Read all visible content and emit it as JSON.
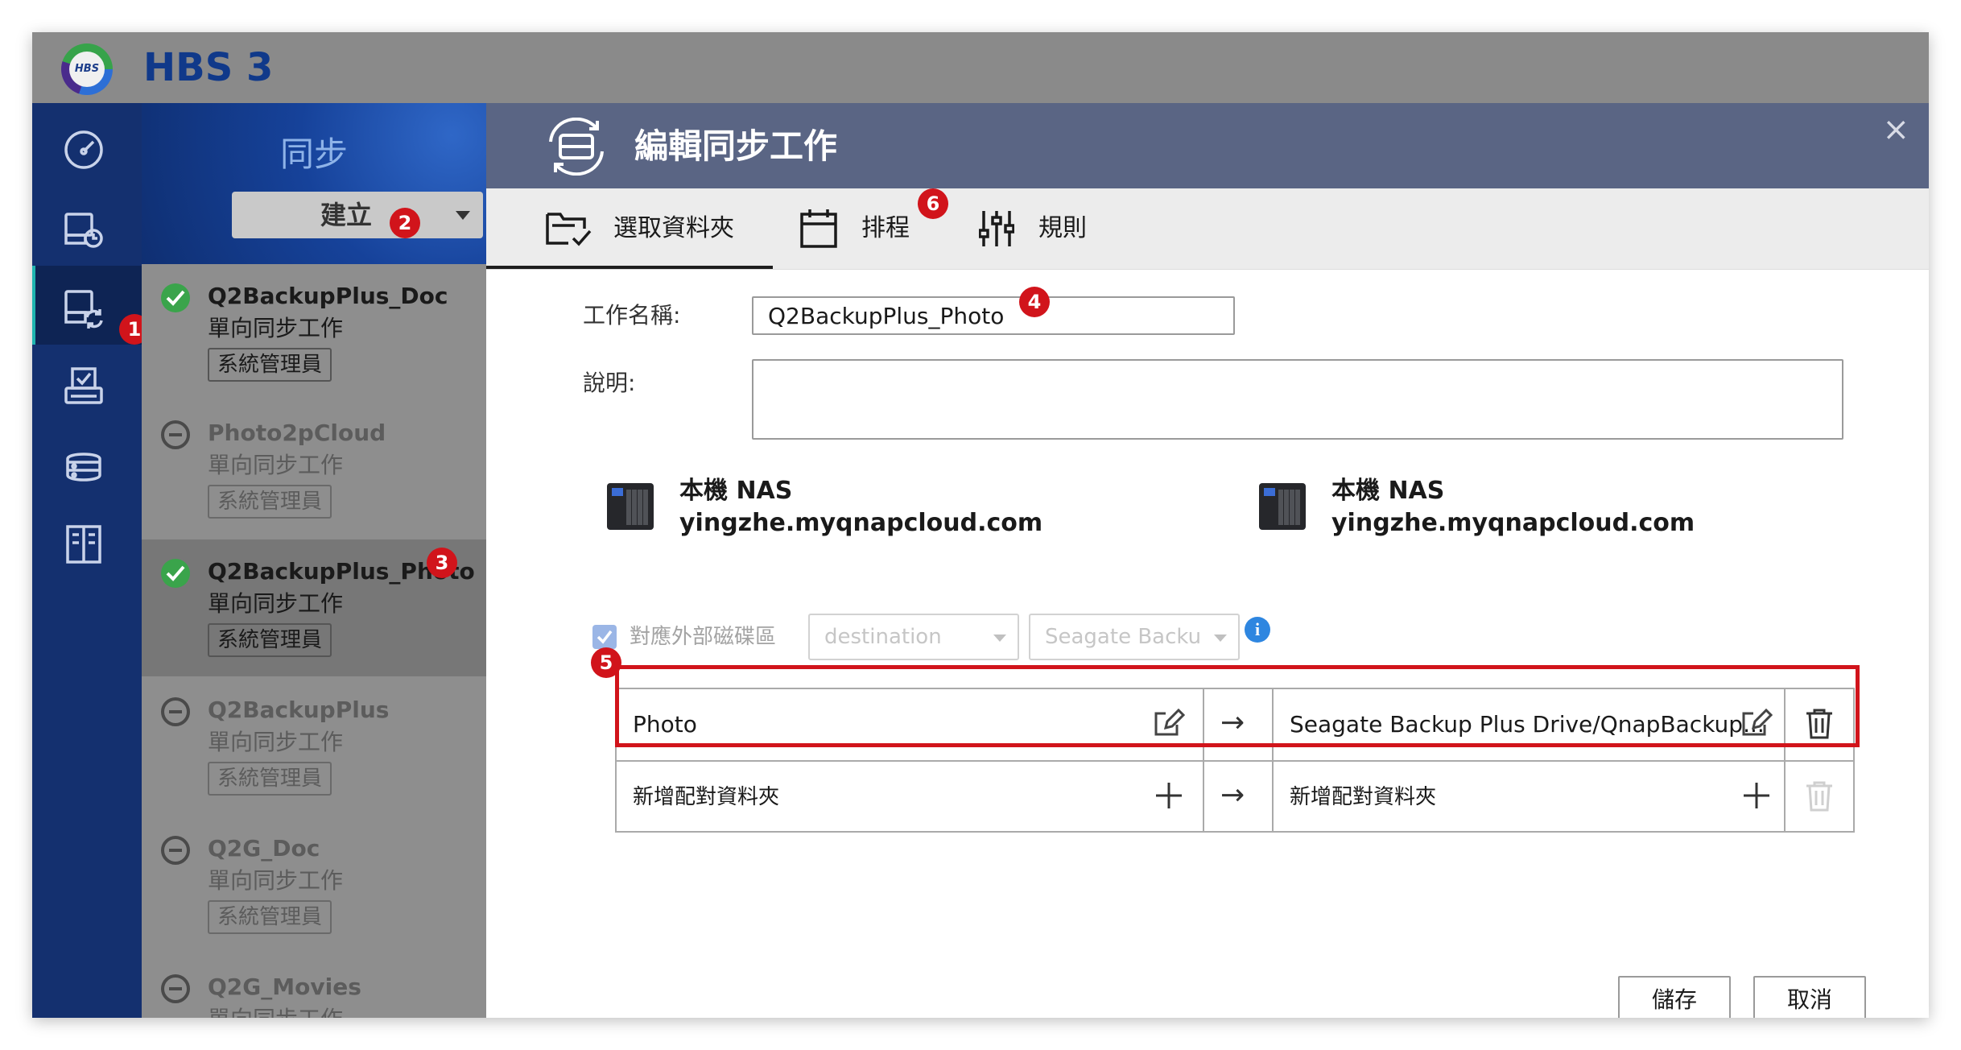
{
  "app": {
    "title": "HBS 3",
    "logo_text": "HBS"
  },
  "sidebar": {
    "icons": [
      "dashboard-icon",
      "backup-restore-icon",
      "sync-icon",
      "services-icon",
      "storage-spaces-icon",
      "logs-icon"
    ],
    "active_index": 2
  },
  "sync_panel": {
    "title": "同步",
    "create_button": "建立",
    "jobs": [
      {
        "name": "Q2BackupPlus_Doc",
        "type": "單向同步工作",
        "owner": "系統管理員",
        "status": "enabled"
      },
      {
        "name": "Photo2pCloud",
        "type": "單向同步工作",
        "owner": "系統管理員",
        "status": "disabled"
      },
      {
        "name": "Q2BackupPlus_Photo",
        "type": "單向同步工作",
        "owner": "系統管理員",
        "status": "enabled",
        "selected": true
      },
      {
        "name": "Q2BackupPlus",
        "type": "單向同步工作",
        "owner": "系統管理員",
        "status": "disabled"
      },
      {
        "name": "Q2G_Doc",
        "type": "單向同步工作",
        "owner": "系統管理員",
        "status": "disabled"
      },
      {
        "name": "Q2G_Movies",
        "type": "單向同步工作",
        "owner": "系統管理員",
        "status": "disabled"
      }
    ]
  },
  "dialog": {
    "title": "編輯同步工作",
    "close": "×",
    "tabs": [
      {
        "label": "選取資料夾",
        "active": true
      },
      {
        "label": "排程",
        "active": false
      },
      {
        "label": "規則",
        "active": false
      }
    ],
    "job_name_label": "工作名稱:",
    "job_name_value": "Q2BackupPlus_Photo",
    "description_label": "說明:",
    "description_value": "",
    "source": {
      "name": "本機 NAS",
      "host": "yingzhe.myqnapcloud.com"
    },
    "destination": {
      "name": "本機 NAS",
      "host": "yingzhe.myqnapcloud.com"
    },
    "external_mapping": {
      "label": "對應外部磁碟區",
      "checked": true,
      "disabled": true,
      "volume_select": "destination",
      "drive_select": "Seagate Backu"
    },
    "folder_pairs": [
      {
        "source": "Photo",
        "arrow": "→",
        "destination": "Seagate Backup Plus Drive/QnapBackup..."
      }
    ],
    "add_pair": {
      "source": "新增配對資料夾",
      "arrow": "→",
      "destination": "新增配對資料夾"
    },
    "save_button": "儲存",
    "cancel_button": "取消"
  },
  "annotations": [
    "1",
    "2",
    "3",
    "4",
    "5",
    "6"
  ],
  "colors": {
    "highlight": "#d1141b",
    "rail": "#14306f",
    "dialog_header": "#5a6584",
    "title_blue": "#10398a",
    "ok_green": "#3aa44b"
  }
}
